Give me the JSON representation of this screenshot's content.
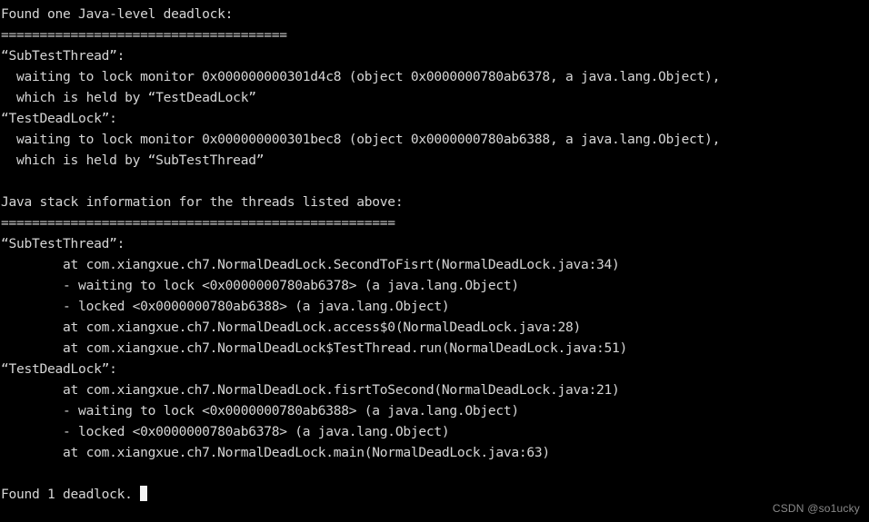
{
  "terminal": {
    "background_color": "#000000",
    "text_color": "#d6d6d6",
    "cursor_color": "#f2f2f2",
    "lines": [
      "Found one Java-level deadlock:",
      "=====================================",
      "“SubTestThread”:",
      "  waiting to lock monitor 0x000000000301d4c8 (object 0x0000000780ab6378, a java.lang.Object),",
      "  which is held by “TestDeadLock”",
      "“TestDeadLock”:",
      "  waiting to lock monitor 0x000000000301bec8 (object 0x0000000780ab6388, a java.lang.Object),",
      "  which is held by “SubTestThread”",
      "",
      "Java stack information for the threads listed above:",
      "===================================================",
      "“SubTestThread”:",
      "        at com.xiangxue.ch7.NormalDeadLock.SecondToFisrt(NormalDeadLock.java:34)",
      "        - waiting to lock <0x0000000780ab6378> (a java.lang.Object)",
      "        - locked <0x0000000780ab6388> (a java.lang.Object)",
      "        at com.xiangxue.ch7.NormalDeadLock.access$0(NormalDeadLock.java:28)",
      "        at com.xiangxue.ch7.NormalDeadLock$TestThread.run(NormalDeadLock.java:51)",
      "“TestDeadLock”:",
      "        at com.xiangxue.ch7.NormalDeadLock.fisrtToSecond(NormalDeadLock.java:21)",
      "        - waiting to lock <0x0000000780ab6388> (a java.lang.Object)",
      "        - locked <0x0000000780ab6378> (a java.lang.Object)",
      "        at com.xiangxue.ch7.NormalDeadLock.main(NormalDeadLock.java:63)",
      "",
      "Found 1 deadlock."
    ],
    "cursor_line_index": 23
  },
  "watermark": {
    "text": "CSDN @so1ucky",
    "color": "#8a8a8a"
  }
}
